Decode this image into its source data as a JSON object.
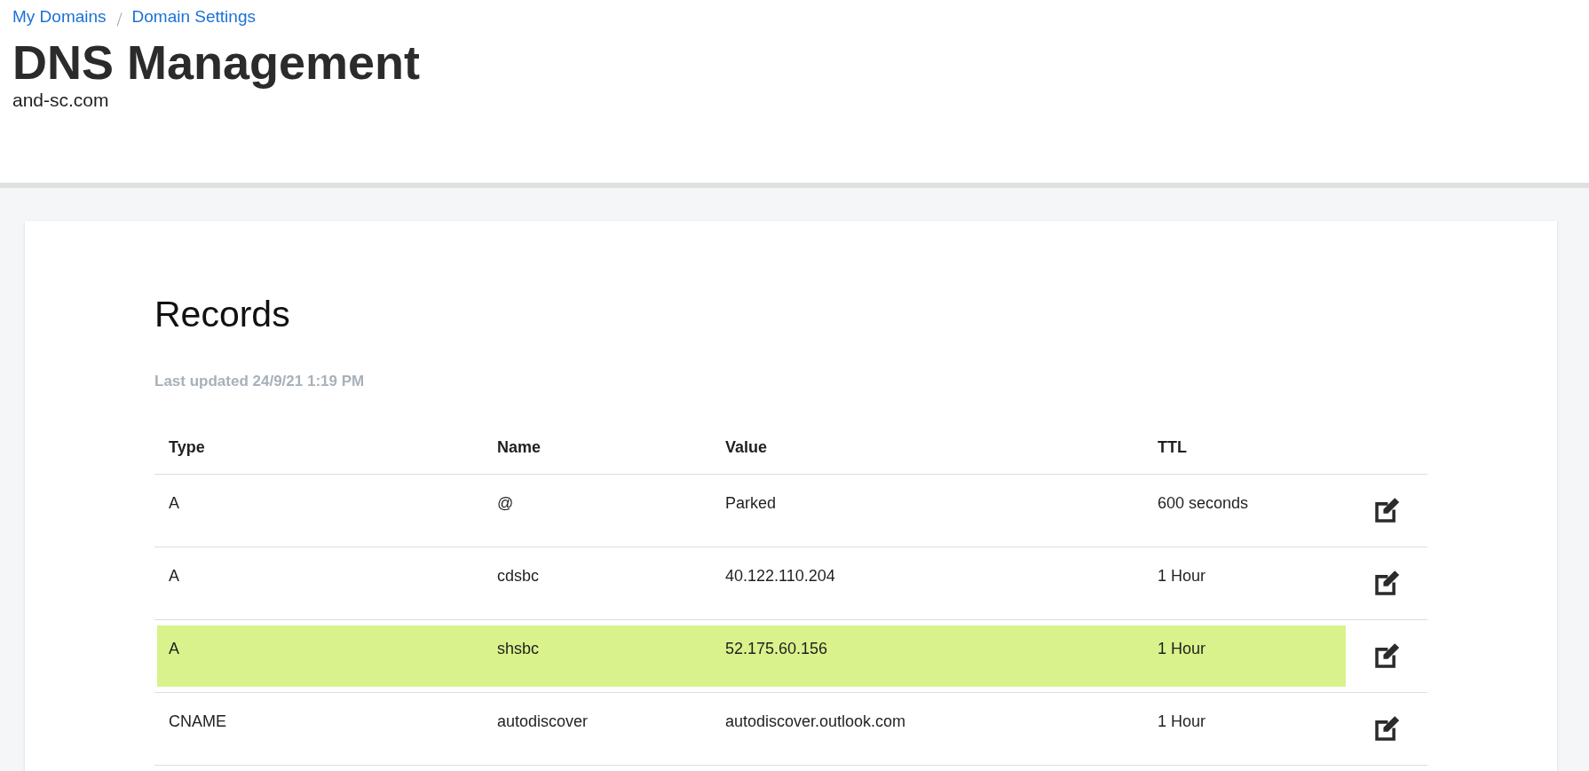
{
  "breadcrumbs": [
    "My Domains",
    "Domain Settings"
  ],
  "title": "DNS Management",
  "domain": "and-sc.com",
  "records": {
    "title": "Records",
    "last_updated": "Last updated 24/9/21 1:19 PM",
    "columns": [
      "Type",
      "Name",
      "Value",
      "TTL"
    ],
    "rows": [
      {
        "type": "A",
        "name": "@",
        "value": "Parked",
        "ttl": "600 seconds",
        "highlighted": false
      },
      {
        "type": "A",
        "name": "cdsbc",
        "value": "40.122.110.204",
        "ttl": "1 Hour",
        "highlighted": false
      },
      {
        "type": "A",
        "name": "shsbc",
        "value": "52.175.60.156",
        "ttl": "1 Hour",
        "highlighted": true
      },
      {
        "type": "CNAME",
        "name": "autodiscover",
        "value": "autodiscover.outlook.com",
        "ttl": "1 Hour",
        "highlighted": false
      }
    ]
  }
}
